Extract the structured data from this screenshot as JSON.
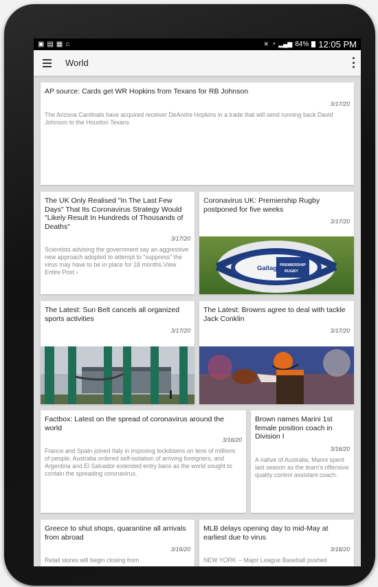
{
  "status_bar": {
    "left_icons": [
      "notification-icon",
      "screenshot-icon",
      "image-icon",
      "cast-icon"
    ],
    "battery": "84%",
    "time": "12:05 PM"
  },
  "app_bar": {
    "title": "World"
  },
  "articles": [
    {
      "title": "AP source: Cards get WR Hopkins from Texans for RB Johnson",
      "date": "3/17/20",
      "summary": "The Arizona Cardinals have acquired receiver DeAndre Hopkins in a trade that will send running back David Johnson to the Houston Texans"
    },
    {
      "title": "The UK Only Realised \"In The Last Few Days\" That Its Coronavirus Strategy Would \"Likely Result In Hundreds of Thousands of Deaths\"",
      "date": "3/17/20",
      "summary": "Scientists advising the government say an aggressive new approach adopted to attempt to \"suppress\" the virus may have to be in place for 18 months.View Entire Post ›"
    },
    {
      "title": "Coronavirus UK: Premiership Rugby postponed for five weeks",
      "date": "3/17/20",
      "image_text": {
        "brand": "Gallagher",
        "league_line1": "PREMIERSHIP",
        "league_line2": "RUGBY"
      }
    },
    {
      "title": "The Latest: Sun Belt cancels all organized sports activities",
      "date": "3/17/20"
    },
    {
      "title": "The Latest: Browns agree to deal with tackle Jack Conklin",
      "date": "3/17/20"
    },
    {
      "title": "Factbox: Latest on the spread of coronavirus around the world",
      "date": "3/16/20",
      "summary": "France and Spain joined Italy in imposing lockdowns on tens of millions of people, Australia ordered self-isolation of arriving foreigners, and Argentina and El Salvador extended entry bans as the world sought to contain the spreading coronavirus."
    },
    {
      "title": "Brown names Marini 1st female position coach in Division I",
      "date": "3/16/20",
      "summary": "A native of Australia, Marini spent last season as the team's offensive quality control assistant coach."
    },
    {
      "title": "Greece to shut shops, quarantine all arrivals from abroad",
      "date": "3/16/20",
      "summary": "Retail stores will begin closing from"
    },
    {
      "title": "MLB delays opening day to mid-May at earliest due to virus",
      "date": "3/16/20",
      "summary": "NEW YORK -- Major League Baseball pushed"
    }
  ]
}
